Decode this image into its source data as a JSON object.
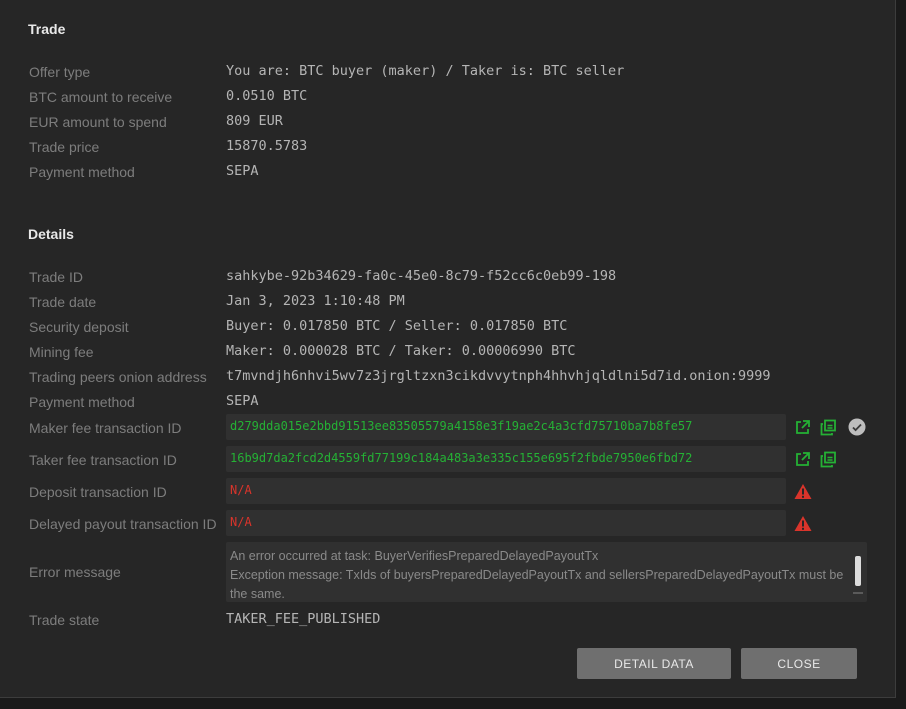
{
  "trade_section": {
    "title": "Trade",
    "rows": [
      {
        "label": "Offer type",
        "value": "You are: BTC buyer (maker) / Taker is: BTC seller"
      },
      {
        "label": "BTC amount to receive",
        "value": "0.0510 BTC"
      },
      {
        "label": "EUR amount to spend",
        "value": "809 EUR"
      },
      {
        "label": "Trade price",
        "value": "15870.5783"
      },
      {
        "label": "Payment method",
        "value": "SEPA"
      }
    ]
  },
  "details_section": {
    "title": "Details",
    "rows": [
      {
        "label": "Trade ID",
        "value": "sahkybe-92b34629-fa0c-45e0-8c79-f52cc6c0eb99-198"
      },
      {
        "label": "Trade date",
        "value": "Jan 3, 2023 1:10:48 PM"
      },
      {
        "label": "Security deposit",
        "value": "Buyer: 0.017850 BTC / Seller: 0.017850 BTC"
      },
      {
        "label": "Mining fee",
        "value": "Maker: 0.000028 BTC / Taker: 0.00006990 BTC"
      },
      {
        "label": "Trading peers onion address",
        "value": "t7mvndjh6nhvi5wv7z3jrgltzxn3cikdvvytnph4hhvhjqldlni5d7id.onion:9999"
      },
      {
        "label": "Payment method",
        "value": "SEPA"
      }
    ],
    "maker_fee_tx": {
      "label": "Maker fee transaction ID",
      "value": "d279dda015e2bbd91513ee83505579a4158e3f19ae2c4a3cfd75710ba7b8fe57"
    },
    "taker_fee_tx": {
      "label": "Taker fee transaction ID",
      "value": "16b9d7da2fcd2d4559fd77199c184a483a3e335c155e695f2fbde7950e6fbd72"
    },
    "deposit_tx": {
      "label": "Deposit transaction ID",
      "value": "N/A"
    },
    "delayed_payout_tx": {
      "label": "Delayed payout transaction ID",
      "value": "N/A"
    },
    "error": {
      "label": "Error message",
      "value": "An error occurred at task: BuyerVerifiesPreparedDelayedPayoutTx\nException message: TxIds of buyersPreparedDelayedPayoutTx and sellersPreparedDelayedPayoutTx must be the same."
    },
    "trade_state": {
      "label": "Trade state",
      "value": "TAKER_FEE_PUBLISHED"
    }
  },
  "buttons": {
    "detail_data": "DETAIL DATA",
    "close": "CLOSE"
  },
  "colors": {
    "green": "#25b135",
    "red": "#d9342b",
    "button": "#6f6f6f",
    "background": "#262626"
  },
  "icons": [
    "open-external-icon",
    "copy-icon",
    "confirmed-check-icon",
    "warning-icon"
  ]
}
